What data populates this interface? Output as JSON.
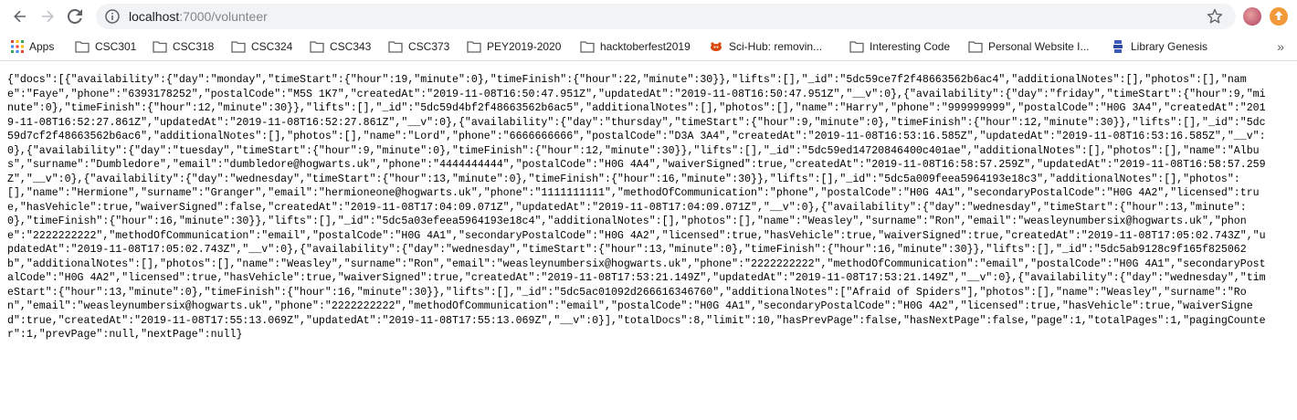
{
  "browser": {
    "url_host": "localhost",
    "url_rest": ":7000/volunteer",
    "bookmarks": [
      {
        "label": "Apps",
        "icon": "apps-grid-icon"
      },
      {
        "label": "CSC301",
        "icon": "folder-icon"
      },
      {
        "label": "CSC318",
        "icon": "folder-icon"
      },
      {
        "label": "CSC324",
        "icon": "folder-icon"
      },
      {
        "label": "CSC343",
        "icon": "folder-icon"
      },
      {
        "label": "CSC373",
        "icon": "folder-icon"
      },
      {
        "label": "PEY2019-2020",
        "icon": "folder-icon"
      },
      {
        "label": "hacktoberfest2019",
        "icon": "folder-icon"
      },
      {
        "label": "Sci-Hub: removin...",
        "icon": "scihub-icon"
      },
      {
        "label": "Interesting Code",
        "icon": "folder-icon"
      },
      {
        "label": "Personal Website I...",
        "icon": "folder-icon"
      },
      {
        "label": "Library Genesis",
        "icon": "libgen-icon"
      }
    ],
    "more_label": "»"
  },
  "content": {
    "json_text": "{\"docs\":[{\"availability\":{\"day\":\"monday\",\"timeStart\":{\"hour\":19,\"minute\":0},\"timeFinish\":{\"hour\":22,\"minute\":30}},\"lifts\":[],\"_id\":\"5dc59ce7f2f48663562b6ac4\",\"additionalNotes\":[],\"photos\":[],\"name\":\"Faye\",\"phone\":\"6393178252\",\"postalCode\":\"M5S 1K7\",\"createdAt\":\"2019-11-08T16:50:47.951Z\",\"updatedAt\":\"2019-11-08T16:50:47.951Z\",\"__v\":0},{\"availability\":{\"day\":\"friday\",\"timeStart\":{\"hour\":9,\"minute\":0},\"timeFinish\":{\"hour\":12,\"minute\":30}},\"lifts\":[],\"_id\":\"5dc59d4bf2f48663562b6ac5\",\"additionalNotes\":[],\"photos\":[],\"name\":\"Harry\",\"phone\":\"999999999\",\"postalCode\":\"H0G 3A4\",\"createdAt\":\"2019-11-08T16:52:27.861Z\",\"updatedAt\":\"2019-11-08T16:52:27.861Z\",\"__v\":0},{\"availability\":{\"day\":\"thursday\",\"timeStart\":{\"hour\":9,\"minute\":0},\"timeFinish\":{\"hour\":12,\"minute\":30}},\"lifts\":[],\"_id\":\"5dc59d7cf2f48663562b6ac6\",\"additionalNotes\":[],\"photos\":[],\"name\":\"Lord\",\"phone\":\"6666666666\",\"postalCode\":\"D3A 3A4\",\"createdAt\":\"2019-11-08T16:53:16.585Z\",\"updatedAt\":\"2019-11-08T16:53:16.585Z\",\"__v\":0},{\"availability\":{\"day\":\"tuesday\",\"timeStart\":{\"hour\":9,\"minute\":0},\"timeFinish\":{\"hour\":12,\"minute\":30}},\"lifts\":[],\"_id\":\"5dc59ed14720846400c401ae\",\"additionalNotes\":[],\"photos\":[],\"name\":\"Albus\",\"surname\":\"Dumbledore\",\"email\":\"dumbledore@hogwarts.uk\",\"phone\":\"4444444444\",\"postalCode\":\"H0G 4A4\",\"waiverSigned\":true,\"createdAt\":\"2019-11-08T16:58:57.259Z\",\"updatedAt\":\"2019-11-08T16:58:57.259Z\",\"__v\":0},{\"availability\":{\"day\":\"wednesday\",\"timeStart\":{\"hour\":13,\"minute\":0},\"timeFinish\":{\"hour\":16,\"minute\":30}},\"lifts\":[],\"_id\":\"5dc5a009feea5964193e18c3\",\"additionalNotes\":[],\"photos\":[],\"name\":\"Hermione\",\"surname\":\"Granger\",\"email\":\"hermioneone@hogwarts.uk\",\"phone\":\"1111111111\",\"methodOfCommunication\":\"phone\",\"postalCode\":\"H0G 4A1\",\"secondaryPostalCode\":\"H0G 4A2\",\"licensed\":true,\"hasVehicle\":true,\"waiverSigned\":false,\"createdAt\":\"2019-11-08T17:04:09.071Z\",\"updatedAt\":\"2019-11-08T17:04:09.071Z\",\"__v\":0},{\"availability\":{\"day\":\"wednesday\",\"timeStart\":{\"hour\":13,\"minute\":0},\"timeFinish\":{\"hour\":16,\"minute\":30}},\"lifts\":[],\"_id\":\"5dc5a03efeea5964193e18c4\",\"additionalNotes\":[],\"photos\":[],\"name\":\"Weasley\",\"surname\":\"Ron\",\"email\":\"weasleynumbersix@hogwarts.uk\",\"phone\":\"2222222222\",\"methodOfCommunication\":\"email\",\"postalCode\":\"H0G 4A1\",\"secondaryPostalCode\":\"H0G 4A2\",\"licensed\":true,\"hasVehicle\":true,\"waiverSigned\":true,\"createdAt\":\"2019-11-08T17:05:02.743Z\",\"updatedAt\":\"2019-11-08T17:05:02.743Z\",\"__v\":0},{\"availability\":{\"day\":\"wednesday\",\"timeStart\":{\"hour\":13,\"minute\":0},\"timeFinish\":{\"hour\":16,\"minute\":30}},\"lifts\":[],\"_id\":\"5dc5ab9128c9f165f825062b\",\"additionalNotes\":[],\"photos\":[],\"name\":\"Weasley\",\"surname\":\"Ron\",\"email\":\"weasleynumbersix@hogwarts.uk\",\"phone\":\"2222222222\",\"methodOfCommunication\":\"email\",\"postalCode\":\"H0G 4A1\",\"secondaryPostalCode\":\"H0G 4A2\",\"licensed\":true,\"hasVehicle\":true,\"waiverSigned\":true,\"createdAt\":\"2019-11-08T17:53:21.149Z\",\"updatedAt\":\"2019-11-08T17:53:21.149Z\",\"__v\":0},{\"availability\":{\"day\":\"wednesday\",\"timeStart\":{\"hour\":13,\"minute\":0},\"timeFinish\":{\"hour\":16,\"minute\":30}},\"lifts\":[],\"_id\":\"5dc5ac01092d266616346760\",\"additionalNotes\":[\"Afraid of Spiders\"],\"photos\":[],\"name\":\"Weasley\",\"surname\":\"Ron\",\"email\":\"weasleynumbersix@hogwarts.uk\",\"phone\":\"2222222222\",\"methodOfCommunication\":\"email\",\"postalCode\":\"H0G 4A1\",\"secondaryPostalCode\":\"H0G 4A2\",\"licensed\":true,\"hasVehicle\":true,\"waiverSigned\":true,\"createdAt\":\"2019-11-08T17:55:13.069Z\",\"updatedAt\":\"2019-11-08T17:55:13.069Z\",\"__v\":0}],\"totalDocs\":8,\"limit\":10,\"hasPrevPage\":false,\"hasNextPage\":false,\"page\":1,\"totalPages\":1,\"pagingCounter\":1,\"prevPage\":null,\"nextPage\":null}"
  }
}
